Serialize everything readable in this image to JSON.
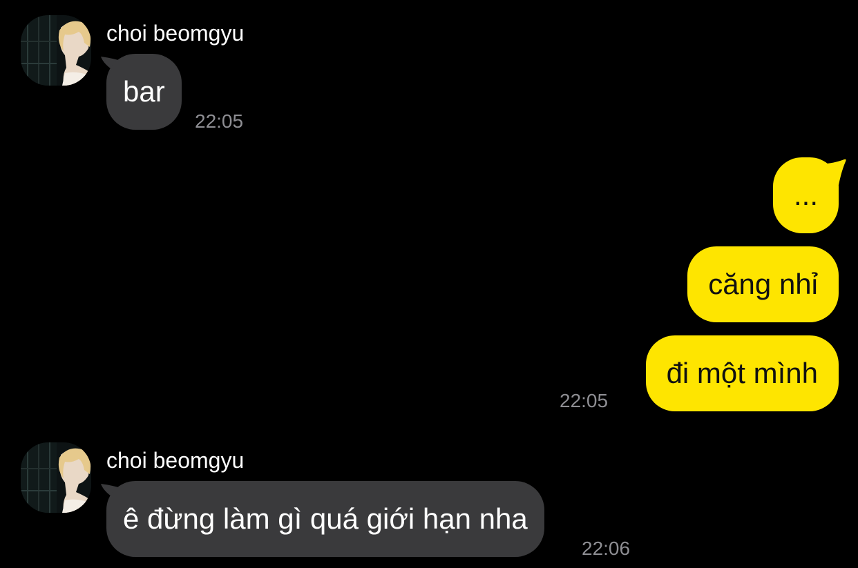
{
  "colors": {
    "background": "#000000",
    "incoming_bubble": "#3a3a3c",
    "outgoing_bubble": "#fee500",
    "timestamp": "#8e8e93"
  },
  "messages": [
    {
      "direction": "incoming",
      "sender": "choi beomgyu",
      "avatar_icon": "profile-photo-avatar",
      "text": "bar",
      "time": "22:05"
    },
    {
      "direction": "outgoing",
      "texts": [
        "...",
        "căng nhỉ",
        "đi một mình"
      ],
      "time": "22:05"
    },
    {
      "direction": "incoming",
      "sender": "choi beomgyu",
      "avatar_icon": "profile-photo-avatar",
      "text": "ê đừng làm gì quá giới hạn nha",
      "time": "22:06"
    }
  ]
}
